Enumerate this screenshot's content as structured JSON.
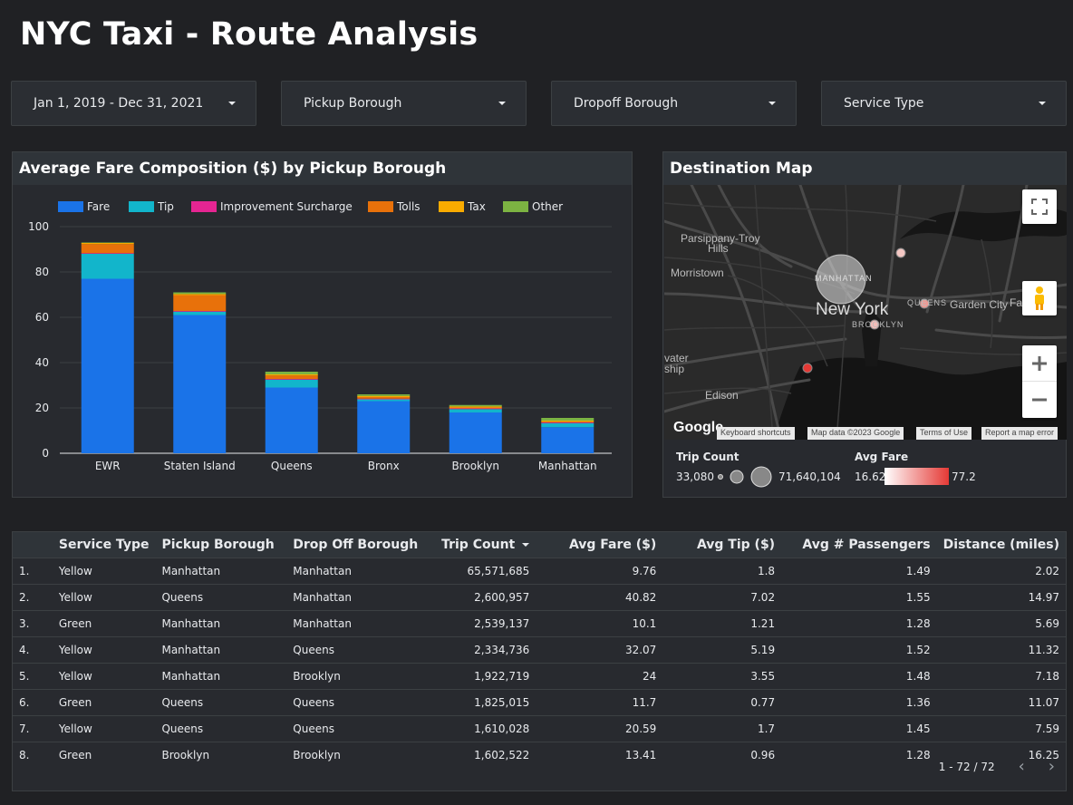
{
  "page": {
    "title": "NYC Taxi - Route Analysis"
  },
  "filters": [
    {
      "label": "Jan 1, 2019 - Dec 31, 2021"
    },
    {
      "label": "Pickup Borough"
    },
    {
      "label": "Dropoff Borough"
    },
    {
      "label": "Service Type"
    }
  ],
  "colors": {
    "Fare": "#1a73e8",
    "Tip": "#12b5cb",
    "Improvement Surcharge": "#e52592",
    "Tolls": "#e8710a",
    "Tax": "#f9ab00",
    "Other": "#7cb342"
  },
  "chart_data": {
    "type": "bar",
    "stacked": true,
    "title": "Average Fare Composition ($) by Pickup Borough",
    "categories": [
      "EWR",
      "Staten Island",
      "Queens",
      "Bronx",
      "Brooklyn",
      "Manhattan"
    ],
    "series": [
      {
        "name": "Fare",
        "values": [
          77,
          61,
          29,
          23,
          18,
          11.5
        ]
      },
      {
        "name": "Tip",
        "values": [
          11,
          1.5,
          3.5,
          0.8,
          1.5,
          1.8
        ]
      },
      {
        "name": "Improvement Surcharge",
        "values": [
          0.3,
          0.3,
          0.3,
          0.3,
          0.3,
          0.3
        ]
      },
      {
        "name": "Tolls",
        "values": [
          4,
          7,
          1.5,
          0.7,
          0.4,
          0.3
        ]
      },
      {
        "name": "Tax",
        "values": [
          0.5,
          0.5,
          0.5,
          0.5,
          0.5,
          0.5
        ]
      },
      {
        "name": "Other",
        "values": [
          0.2,
          0.7,
          1.2,
          0.7,
          0.6,
          1.2
        ]
      }
    ],
    "ylim": [
      0,
      100
    ],
    "yticks": [
      0,
      20,
      40,
      60,
      80,
      100
    ],
    "grid": true,
    "legend": "top"
  },
  "map": {
    "title": "Destination Map",
    "labels": {
      "parsippany": "Parsippany-Troy",
      "hills": "Hills",
      "morristown": "Morristown",
      "manhattan": "MANHATTAN",
      "new_york": "New York",
      "queens": "QUEENS",
      "brooklyn": "BROOKLYN",
      "garden_city": "Garden City",
      "far": "Far",
      "edison": "Edison",
      "water1": "vater",
      "water2": "ship"
    },
    "google": "Google",
    "attribution": [
      "Keyboard shortcuts",
      "Map data ©2023 Google",
      "Terms of Use",
      "Report a map error"
    ],
    "legend": {
      "trip_count_title": "Trip Count",
      "trip_count_min": "33,080",
      "trip_count_max": "71,640,104",
      "avg_fare_title": "Avg Fare",
      "avg_fare_min": "16.62",
      "avg_fare_max": "77.2"
    }
  },
  "table": {
    "headers": [
      "Service Type",
      "Pickup Borough",
      "Drop Off Borough",
      "Trip Count",
      "Avg Fare ($)",
      "Avg Tip ($)",
      "Avg # Passengers",
      "Distance (miles)"
    ],
    "rows": [
      [
        "1.",
        "Yellow",
        "Manhattan",
        "Manhattan",
        "65,571,685",
        "9.76",
        "1.8",
        "1.49",
        "2.02"
      ],
      [
        "2.",
        "Yellow",
        "Queens",
        "Manhattan",
        "2,600,957",
        "40.82",
        "7.02",
        "1.55",
        "14.97"
      ],
      [
        "3.",
        "Green",
        "Manhattan",
        "Manhattan",
        "2,539,137",
        "10.1",
        "1.21",
        "1.28",
        "5.69"
      ],
      [
        "4.",
        "Yellow",
        "Manhattan",
        "Queens",
        "2,334,736",
        "32.07",
        "5.19",
        "1.52",
        "11.32"
      ],
      [
        "5.",
        "Yellow",
        "Manhattan",
        "Brooklyn",
        "1,922,719",
        "24",
        "3.55",
        "1.48",
        "7.18"
      ],
      [
        "6.",
        "Green",
        "Queens",
        "Queens",
        "1,825,015",
        "11.7",
        "0.77",
        "1.36",
        "11.07"
      ],
      [
        "7.",
        "Yellow",
        "Queens",
        "Queens",
        "1,610,028",
        "20.59",
        "1.7",
        "1.45",
        "7.59"
      ],
      [
        "8.",
        "Green",
        "Brooklyn",
        "Brooklyn",
        "1,602,522",
        "13.41",
        "0.96",
        "1.28",
        "16.25"
      ]
    ],
    "pagination": "1 - 72 / 72"
  }
}
